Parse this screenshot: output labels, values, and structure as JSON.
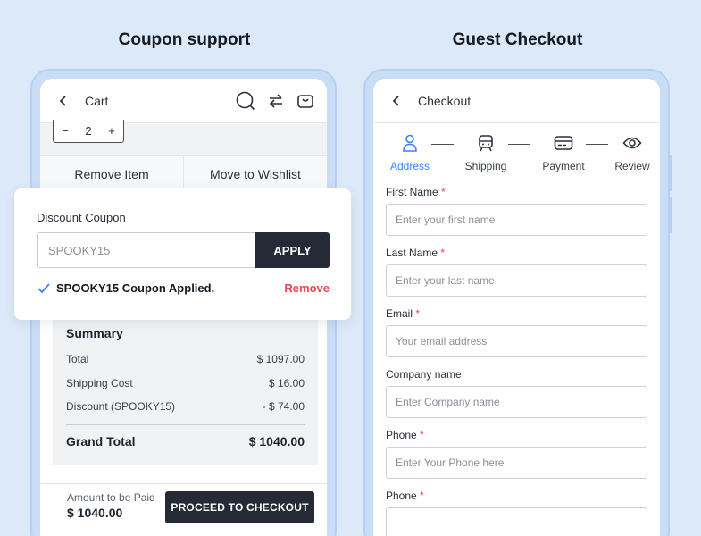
{
  "left_section": {
    "title": "Coupon support"
  },
  "right_section": {
    "title": "Guest Checkout"
  },
  "cart": {
    "title": "Cart",
    "quantity": "2",
    "remove_item": "Remove Item",
    "move_to_wishlist": "Move to Wishlist",
    "coupon": {
      "label": "Discount Coupon",
      "value": "SPOOKY15",
      "apply_label": "APPLY",
      "applied_text": "SPOOKY15 Coupon Applied.",
      "remove_label": "Remove"
    },
    "summary": {
      "title": "Summary",
      "rows": [
        {
          "label": "Total",
          "value": "$ 1097.00"
        },
        {
          "label": "Shipping Cost",
          "value": "$ 16.00"
        },
        {
          "label": "Discount (SPOOKY15)",
          "value": "- $ 74.00"
        }
      ],
      "grand_total_label": "Grand Total",
      "grand_total_value": "$ 1040.00"
    },
    "amount_label": "Amount to be Paid",
    "amount_value": "$ 1040.00",
    "proceed_label": "PROCEED TO CHECKOUT"
  },
  "checkout": {
    "title": "Checkout",
    "steps": [
      {
        "label": "Address",
        "icon": "person-icon"
      },
      {
        "label": "Shipping",
        "icon": "train-icon"
      },
      {
        "label": "Payment",
        "icon": "card-icon"
      },
      {
        "label": "Review",
        "icon": "eye-icon"
      }
    ],
    "fields": [
      {
        "label": "First Name",
        "required": "*",
        "placeholder": "Enter your first name"
      },
      {
        "label": "Last Name",
        "required": "*",
        "placeholder": "Enter your last name"
      },
      {
        "label": "Email",
        "required": "*",
        "placeholder": "Your email address"
      },
      {
        "label": "Company name",
        "required": "",
        "placeholder": "Enter Company name"
      },
      {
        "label": "Phone",
        "required": "*",
        "placeholder": "Enter Your Phone here"
      },
      {
        "label": "Phone",
        "required": "*",
        "placeholder": ""
      }
    ]
  },
  "colors": {
    "accent": "#3b82f6",
    "dark": "#252a36",
    "danger": "#e5484d",
    "background": "#dce9f8"
  }
}
